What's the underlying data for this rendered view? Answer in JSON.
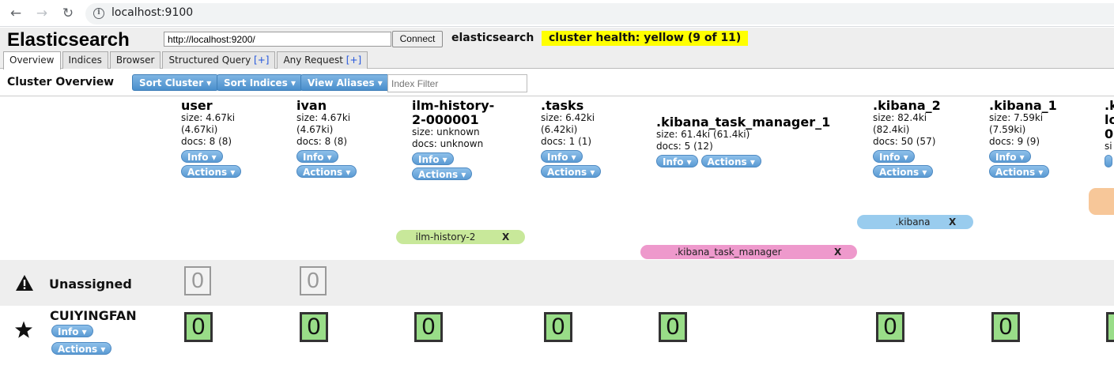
{
  "browser": {
    "url": "localhost:9100"
  },
  "app": {
    "title": "Elasticsearch",
    "connect_url": "http://localhost:9200/",
    "connect_label": "Connect",
    "cluster_name": "elasticsearch",
    "health": "cluster health: yellow (9 of 11)",
    "health_color": "#ffff00"
  },
  "tabs": [
    {
      "label": "Overview",
      "plus": ""
    },
    {
      "label": "Indices",
      "plus": ""
    },
    {
      "label": "Browser",
      "plus": ""
    },
    {
      "label": "Structured Query",
      "plus": "[+]"
    },
    {
      "label": "Any Request",
      "plus": "[+]"
    }
  ],
  "toolbar": {
    "title": "Cluster Overview",
    "sort_cluster": "Sort Cluster ▾",
    "sort_indices": "Sort Indices ▾",
    "view_aliases": "View Aliases ▾",
    "filter_placeholder": "Index Filter"
  },
  "buttons": {
    "info": "Info ▾",
    "actions": "Actions ▾"
  },
  "indices": [
    {
      "name": "user",
      "name2": "",
      "size": "size: 4.67ki",
      "size2": "(4.67ki)",
      "docs": "docs: 8 (8)"
    },
    {
      "name": "ivan",
      "name2": "",
      "size": "size: 4.67ki",
      "size2": "(4.67ki)",
      "docs": "docs: 8 (8)"
    },
    {
      "name": "ilm-history-",
      "name2": "2-000001",
      "size": "size: unknown",
      "size2": "",
      "docs": "docs: unknown"
    },
    {
      "name": ".tasks",
      "name2": "",
      "size": "size: 6.42ki",
      "size2": "(6.42ki)",
      "docs": "docs: 1 (1)"
    },
    {
      "name": ".kibana_task_manager_1",
      "name2": "",
      "size": "size: 61.4ki (61.4ki)",
      "size2": "",
      "docs": "docs: 5 (12)"
    },
    {
      "name": ".kibana_2",
      "name2": "",
      "size": "size: 82.4ki",
      "size2": "(82.4ki)",
      "docs": "docs: 50 (57)"
    },
    {
      "name": ".kibana_1",
      "name2": "",
      "size": "size: 7.59ki",
      "size2": "(7.59ki)",
      "docs": "docs: 9 (9)"
    }
  ],
  "aliases": [
    {
      "label": "ilm-history-2",
      "x": "X",
      "color": "#c8e89a"
    },
    {
      "label": ".kibana_task_manager",
      "x": "X",
      "color": "#ee99cc"
    },
    {
      "label": ".kibana",
      "x": "X",
      "color": "#99ccee"
    }
  ],
  "unassigned": {
    "label": "Unassigned",
    "shards": [
      "0",
      "0"
    ]
  },
  "node": {
    "name": "CUIYINGFAN",
    "shards": [
      "0",
      "0",
      "0",
      "0",
      "0",
      "0",
      "0"
    ]
  }
}
